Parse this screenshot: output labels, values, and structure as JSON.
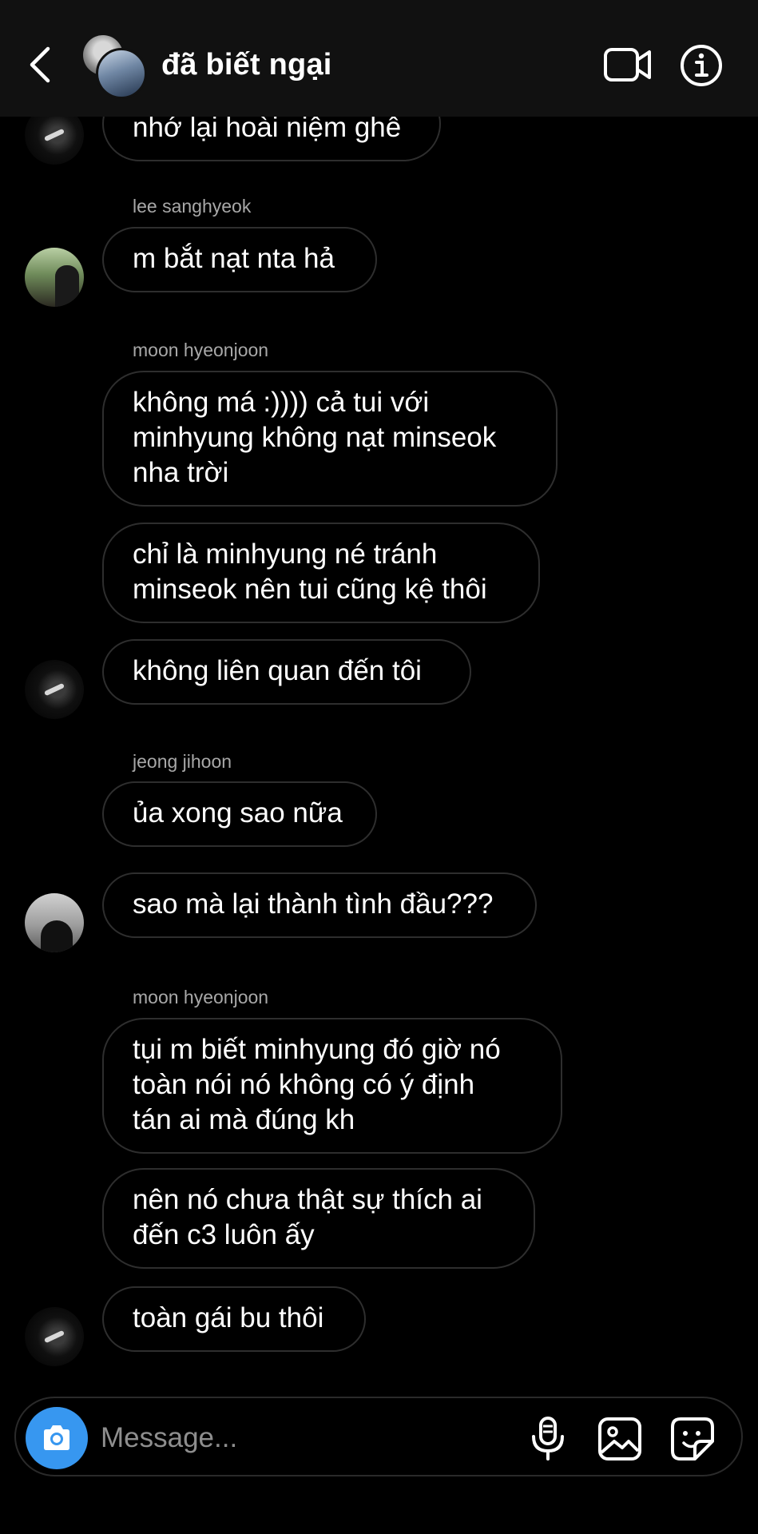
{
  "header": {
    "title": "đã biết ngại"
  },
  "messages": [
    {
      "text": "nhớ lại hoài niệm ghê"
    },
    {
      "sender": "lee sanghyeok"
    },
    {
      "text": "m bắt nạt nta hả"
    },
    {
      "sender": "moon hyeonjoon"
    },
    {
      "text": "không má :)))) cả tui với\nminhyung không nạt minseok\nnha trời"
    },
    {
      "text": "chỉ là minhyung né tránh\nminseok nên tui cũng kệ thôi"
    },
    {
      "text": "không liên quan đến tôi"
    },
    {
      "sender": "jeong jihoon"
    },
    {
      "text": "ủa xong sao nữa"
    },
    {
      "text": "sao mà lại thành tình đầu???"
    },
    {
      "sender": "moon hyeonjoon"
    },
    {
      "text": "tụi m biết minhyung đó giờ nó\ntoàn nói nó không có ý định\ntán ai mà đúng kh"
    },
    {
      "text": "nên nó chưa thật sự thích ai\nđến c3 luôn ấy"
    },
    {
      "text": "toàn gái bu thôi"
    }
  ],
  "composer": {
    "placeholder": "Message..."
  },
  "icons": {
    "back": "chevron-left-icon",
    "video": "video-camera-icon",
    "info": "info-icon",
    "camera": "camera-icon",
    "mic": "microphone-icon",
    "photo": "photo-gallery-icon",
    "sticker": "sticker-icon"
  },
  "colors": {
    "background": "#000000",
    "header": "#111111",
    "bubble_border": "#2e2e2e",
    "sender_text": "#a8a8a8",
    "camera_button": "#3797f0"
  }
}
